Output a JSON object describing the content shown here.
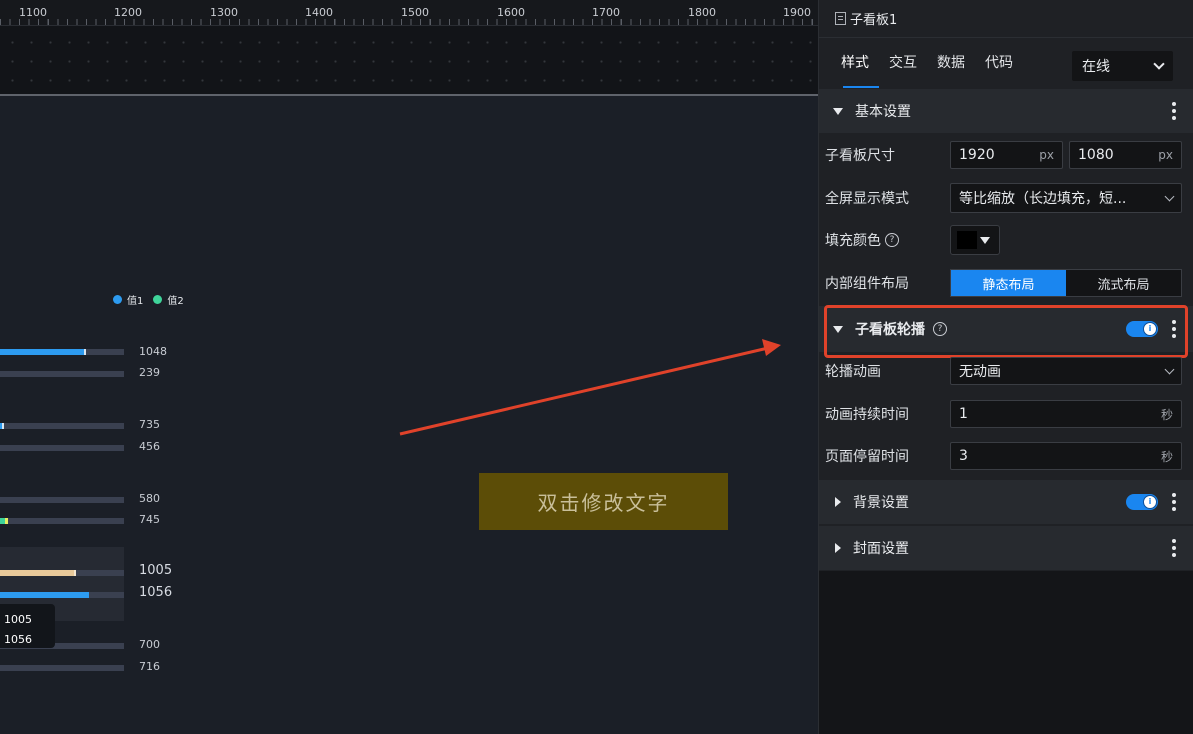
{
  "ruler": {
    "labels": [
      "1100",
      "1200",
      "1300",
      "1400",
      "1500",
      "1600",
      "1700",
      "1800",
      "1900"
    ]
  },
  "chart": {
    "legend": [
      {
        "label": "值1",
        "color": "#2d9bf0"
      },
      {
        "label": "值2",
        "color": "#3fd49a"
      }
    ],
    "rows": [
      {
        "value1": "1048",
        "value2": "239"
      },
      {
        "value1": "735",
        "value2": "456"
      },
      {
        "value1": "580",
        "value2": "745"
      },
      {
        "value1": "1005",
        "value2": "1056"
      },
      {
        "value1": "700",
        "value2": "716"
      }
    ],
    "tooltip": {
      "line1": "1005",
      "line2": "1056"
    }
  },
  "canvas": {
    "text_box": "双击修改文字"
  },
  "panel": {
    "title": "子看板1",
    "tabs": [
      "样式",
      "交互",
      "数据",
      "代码"
    ],
    "mode_select": "在线",
    "basic": {
      "title": "基本设置",
      "size_label": "子看板尺寸",
      "width": "1920",
      "height": "1080",
      "unit_px": "px",
      "fullscreen_label": "全屏显示模式",
      "fullscreen_value": "等比缩放（长边填充，短...",
      "fill_label": "填充颜色",
      "fill_color": "#000000",
      "layout_label": "内部组件布局",
      "layout_static": "静态布局",
      "layout_flow": "流式布局"
    },
    "carousel": {
      "title": "子看板轮播",
      "toggle_on": true,
      "anim_label": "轮播动画",
      "anim_value": "无动画",
      "duration_label": "动画持续时间",
      "duration_value": "1",
      "stay_label": "页面停留时间",
      "stay_value": "3",
      "unit_sec": "秒"
    },
    "background": {
      "title": "背景设置",
      "toggle_on": true
    },
    "cover": {
      "title": "封面设置"
    }
  }
}
